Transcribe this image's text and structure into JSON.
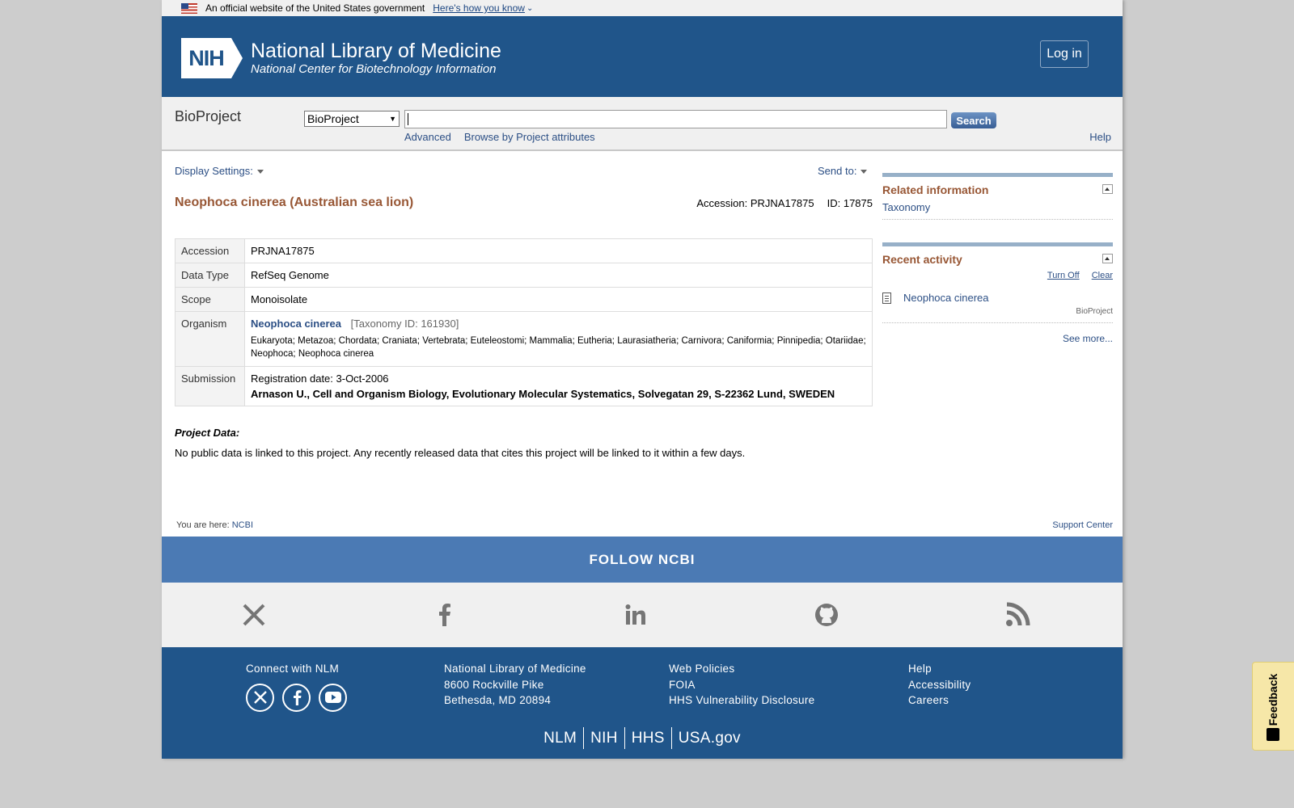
{
  "gov_banner": {
    "text": "An official website of the United States government",
    "link": "Here's how you know"
  },
  "header": {
    "logo_text": "NIH",
    "title": "National Library of Medicine",
    "subtitle": "National Center for Biotechnology Information",
    "login": "Log in",
    "brand_color": "#20558a"
  },
  "search": {
    "db_title": "BioProject",
    "db_selected": "BioProject",
    "query": "",
    "button": "Search",
    "advanced": "Advanced",
    "browse": "Browse by Project attributes",
    "help": "Help"
  },
  "toolbar": {
    "display_settings": "Display Settings:",
    "send_to": "Send to:"
  },
  "record": {
    "title": "Neophoca cinerea (Australian sea lion)",
    "accession_label": "Accession: PRJNA17875",
    "id_label": "ID: 17875",
    "rows": {
      "accession": {
        "key": "Accession",
        "value": "PRJNA17875"
      },
      "data_type": {
        "key": "Data Type",
        "value": "RefSeq Genome"
      },
      "scope": {
        "key": "Scope",
        "value": "Monoisolate"
      },
      "organism": {
        "key": "Organism",
        "name": "Neophoca cinerea",
        "taxid": "[Taxonomy ID: 161930]",
        "lineage": "Eukaryota; Metazoa; Chordata; Craniata; Vertebrata; Euteleostomi; Mammalia; Eutheria; Laurasiatheria; Carnivora; Caniformia; Pinnipedia; Otariidae; Neophoca; Neophoca cinerea"
      },
      "submission": {
        "key": "Submission",
        "date": "Registration date: 3-Oct-2006",
        "author": "Arnason U., Cell and Organism Biology, Evolutionary Molecular Systematics, Solvegatan 29, S-22362 Lund, SWEDEN"
      }
    },
    "project_data_label": "Project Data:",
    "project_data_msg": "No public data is linked to this project. Any recently released data that cites this project will be linked to it within a few days."
  },
  "sidebar": {
    "related": {
      "title": "Related information",
      "link": "Taxonomy"
    },
    "recent": {
      "title": "Recent activity",
      "turn_off": "Turn Off",
      "clear": "Clear",
      "item": "Neophoca cinerea",
      "item_db": "BioProject",
      "see_more": "See more..."
    }
  },
  "breadcrumb": {
    "prefix": "You are here:",
    "link": "NCBI",
    "support": "Support Center"
  },
  "footer": {
    "follow": "FOLLOW NCBI",
    "social": [
      "x-icon",
      "facebook-icon",
      "linkedin-icon",
      "github-icon",
      "rss-icon"
    ],
    "connect": "Connect with NLM",
    "address": [
      "National Library of Medicine",
      "8600 Rockville Pike",
      "Bethesda, MD 20894"
    ],
    "policies": [
      "Web Policies",
      "FOIA",
      "HHS Vulnerability Disclosure"
    ],
    "help": [
      "Help",
      "Accessibility",
      "Careers"
    ],
    "gov_links": [
      "NLM",
      "NIH",
      "HHS",
      "USA.gov"
    ]
  },
  "feedback": "Feedback"
}
